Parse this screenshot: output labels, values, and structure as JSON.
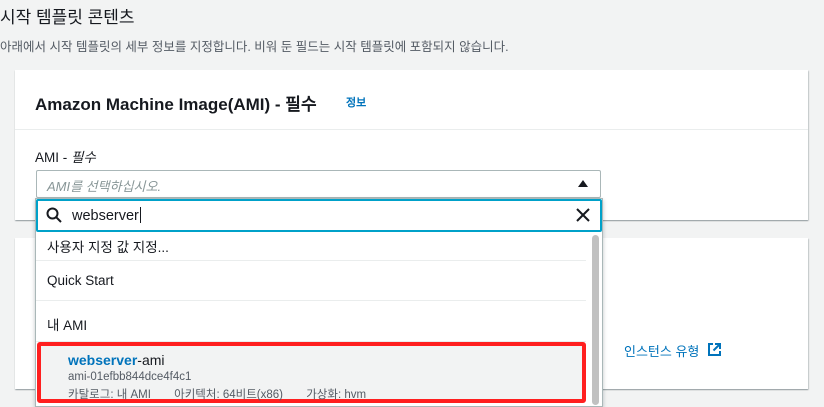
{
  "section": {
    "title": "시작 템플릿 콘텐츠",
    "description": "아래에서 시작 템플릿의 세부 정보를 지정합니다. 비워 둔 필드는 시작 템플릿에 포함되지 않습니다."
  },
  "ami_panel": {
    "title": "Amazon Machine Image(AMI) - 필수",
    "info_link": "정보",
    "field_label": "AMI - ",
    "field_label_required": "필수",
    "select_placeholder": "AMI를 선택하십시오."
  },
  "instance_panel": {
    "instance_type_link": "인스턴스 유형"
  },
  "dropdown": {
    "search_value": "webserver",
    "options": [
      {
        "label": "사용자 지정 값 지정..."
      },
      {
        "label": "Quick Start"
      },
      {
        "label": "내 AMI"
      }
    ],
    "selected": {
      "name_match": "webserver",
      "name_rest": "-ami",
      "ami_id": "ami-01efbb844dce4f4c1",
      "catalog": "카탈로그: 내 AMI",
      "architecture": "아키텍처: 64비트(x86)",
      "virtualization": "가상화: hvm"
    }
  },
  "colors": {
    "link": "#0073bb",
    "focus_border": "#00a1c9",
    "highlight_border": "#ff1f1f"
  },
  "icons": [
    "search-icon",
    "clear-icon",
    "caret-up-icon",
    "external-link-icon"
  ]
}
